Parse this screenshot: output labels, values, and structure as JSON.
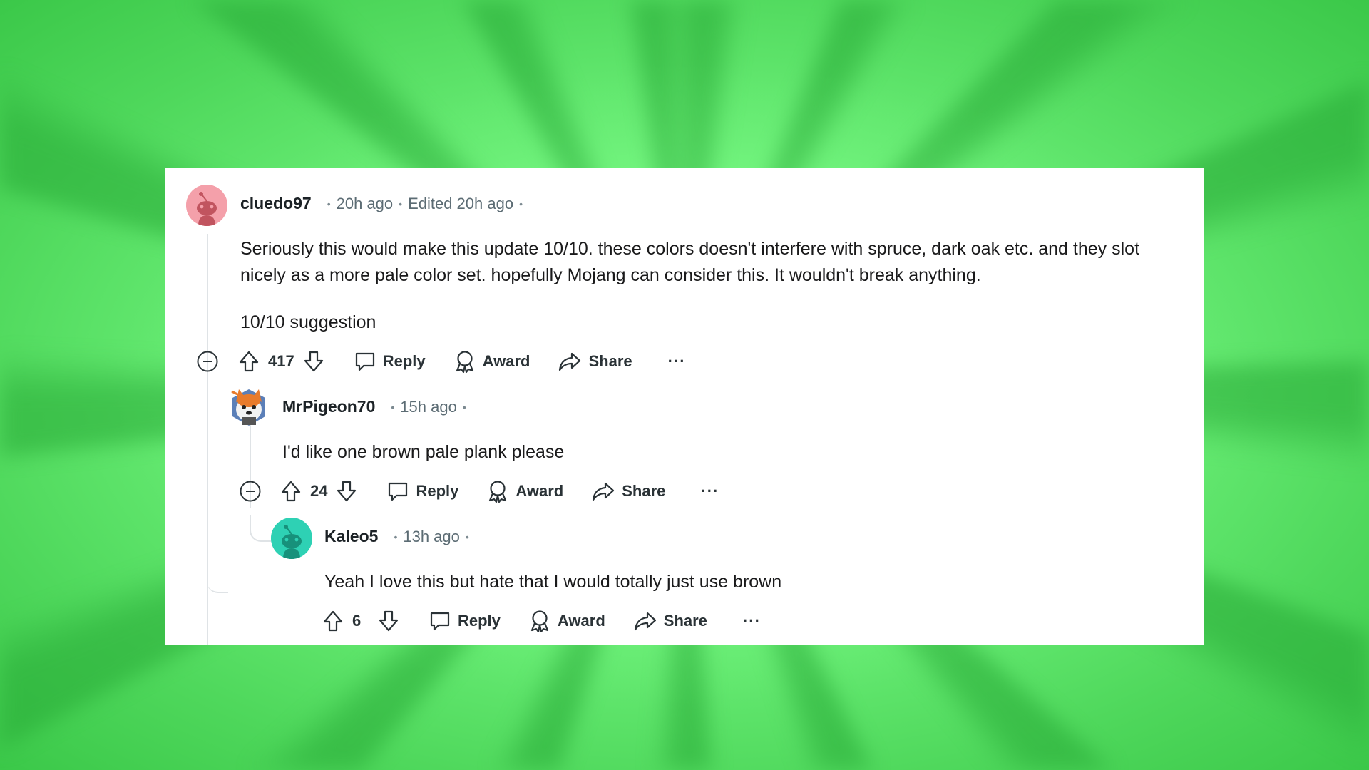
{
  "comments": [
    {
      "username": "cluedo97",
      "time": "20h ago",
      "edited": "Edited 20h ago",
      "paragraphs": [
        "Seriously this would make this update 10/10. these colors doesn't interfere with spruce, dark oak etc. and they slot nicely as a more pale color set. hopefully Mojang can consider this. It wouldn't break anything.",
        "10/10 suggestion"
      ],
      "score": "417",
      "avatar_color": "#f4a0aa"
    },
    {
      "username": "MrPigeon70",
      "time": "15h ago",
      "paragraphs": [
        "I'd like one brown pale plank please"
      ],
      "score": "24"
    },
    {
      "username": "Kaleo5",
      "time": "13h ago",
      "paragraphs": [
        "Yeah I love this but hate that I would totally just use brown"
      ],
      "score": "6",
      "avatar_color": "#2ed1b4"
    }
  ],
  "actions": {
    "reply": "Reply",
    "award": "Award",
    "share": "Share",
    "more": "···"
  },
  "icons": [
    "upvote-icon",
    "downvote-icon",
    "comment-icon",
    "award-icon",
    "share-icon",
    "collapse-icon",
    "more-icon"
  ]
}
